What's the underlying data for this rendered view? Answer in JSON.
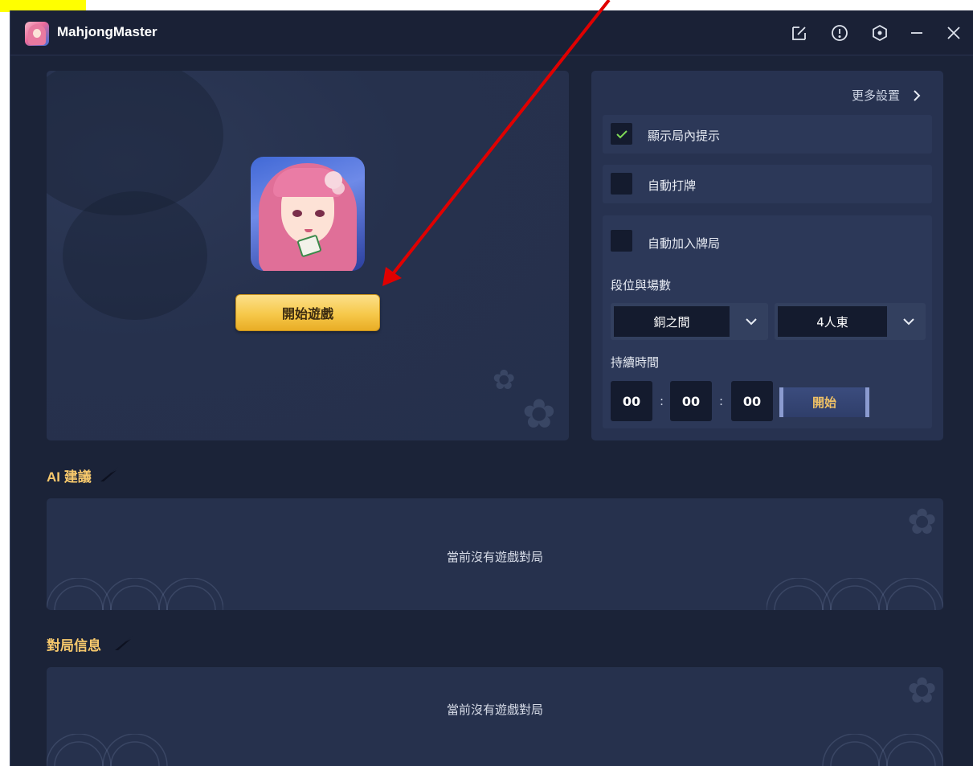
{
  "window": {
    "title": "MahjongMaster"
  },
  "titlebar_icons": [
    "edit-icon",
    "info-icon",
    "settings-icon",
    "minimize-icon",
    "close-icon"
  ],
  "main": {
    "start_game_label": "開始遊戲"
  },
  "settings": {
    "more_settings_label": "更多設置",
    "show_hints": {
      "label": "顯示局內提示",
      "checked": true
    },
    "auto_play": {
      "label": "自動打牌",
      "checked": false
    },
    "auto_join": {
      "label": "自動加入牌局",
      "checked": false
    },
    "rank_label": "段位與場數",
    "rank_select": "銅之間",
    "mode_select": "4人東",
    "duration_label": "持續時間",
    "hours": "00",
    "minutes": "00",
    "seconds": "00",
    "time_separator": ":",
    "start_label": "開始"
  },
  "ai_section": {
    "title": "AI 建議",
    "empty_text": "當前沒有遊戲對局"
  },
  "match_section": {
    "title": "對局信息",
    "empty_text": "當前沒有遊戲對局"
  },
  "colors": {
    "accent_gold": "#f6c86c",
    "check_green": "#7ed957",
    "annotation_red": "#e00000",
    "highlight_yellow": "#ffff00"
  }
}
